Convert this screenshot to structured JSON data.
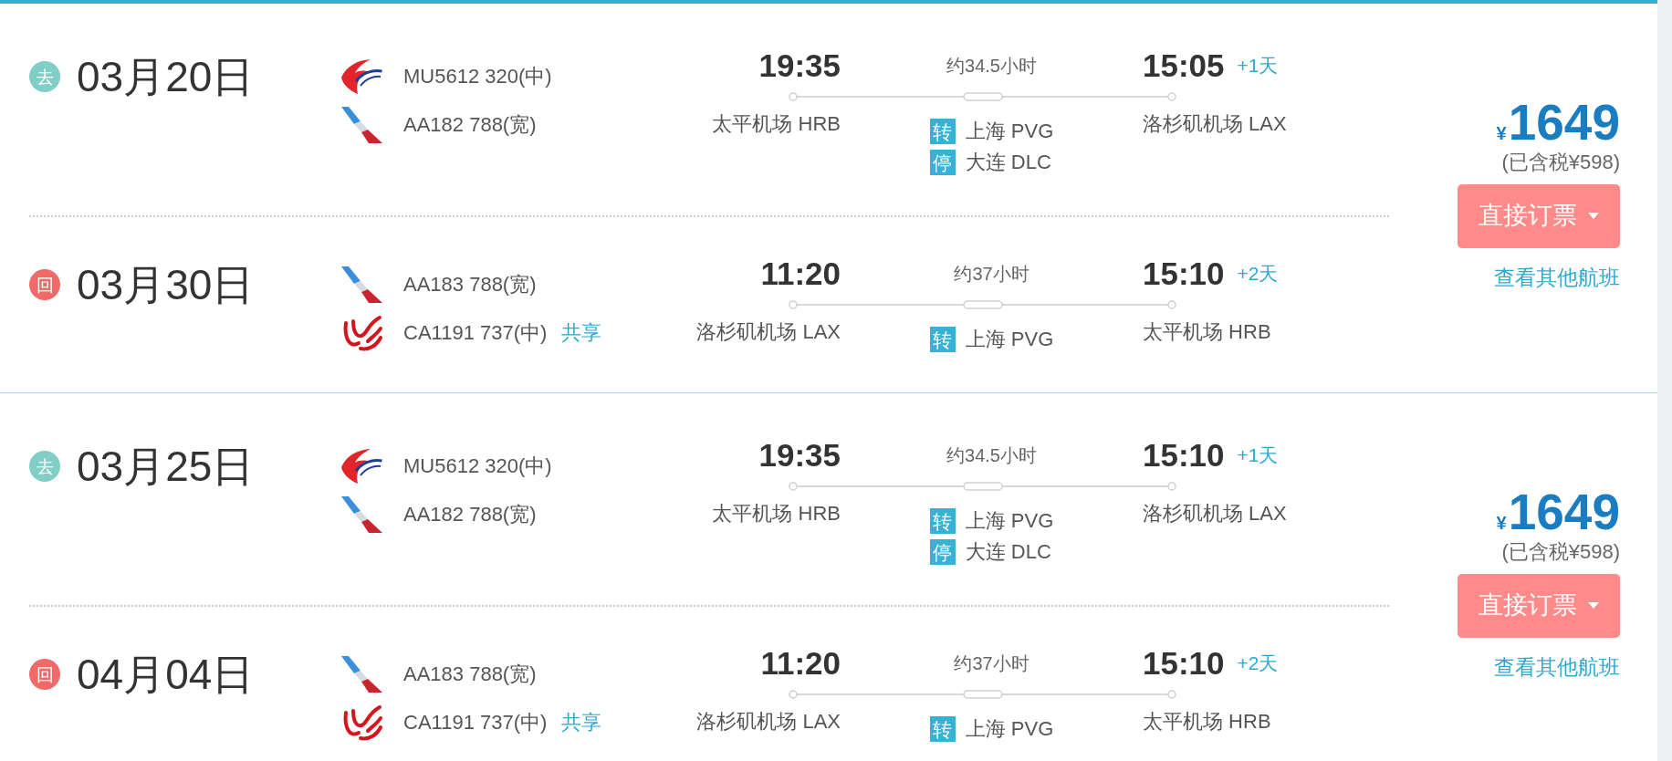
{
  "trips": [
    {
      "segments": [
        {
          "direction": {
            "kind": "outbound",
            "label": "去"
          },
          "date": "03月20日",
          "flights": [
            {
              "kind": "swoosh",
              "number": "MU5612 320(中)"
            },
            {
              "kind": "tailfin",
              "number": "AA182 788(宽)"
            }
          ],
          "departure": {
            "time": "19:35",
            "airport": "太平机场 HRB"
          },
          "duration": "约34.5小时",
          "arrival": {
            "time": "15:05",
            "day_offset": "+1天",
            "airport": "洛杉矶机场 LAX"
          },
          "stops": [
            {
              "label": "转",
              "place": "上海 PVG"
            },
            {
              "label": "停",
              "place": "大连 DLC"
            }
          ]
        },
        {
          "direction": {
            "kind": "return",
            "label": "回"
          },
          "date": "03月30日",
          "flights": [
            {
              "kind": "tailfin",
              "number": "AA183 788(宽)"
            },
            {
              "kind": "ribbon",
              "number": "CA1191 737(中)",
              "codeshare": "共享"
            }
          ],
          "departure": {
            "time": "11:20",
            "airport": "洛杉矶机场 LAX"
          },
          "duration": "约37小时",
          "arrival": {
            "time": "15:10",
            "day_offset": "+2天",
            "airport": "太平机场 HRB"
          },
          "stops": [
            {
              "label": "转",
              "place": "上海 PVG"
            }
          ]
        }
      ],
      "price": {
        "currency": "¥",
        "amount": "1649",
        "tax_note": "(已含税¥598)"
      },
      "book_button": "直接订票",
      "other_flights_link": "查看其他航班"
    },
    {
      "segments": [
        {
          "direction": {
            "kind": "outbound",
            "label": "去"
          },
          "date": "03月25日",
          "flights": [
            {
              "kind": "swoosh",
              "number": "MU5612 320(中)"
            },
            {
              "kind": "tailfin",
              "number": "AA182 788(宽)"
            }
          ],
          "departure": {
            "time": "19:35",
            "airport": "太平机场 HRB"
          },
          "duration": "约34.5小时",
          "arrival": {
            "time": "15:10",
            "day_offset": "+1天",
            "airport": "洛杉矶机场 LAX"
          },
          "stops": [
            {
              "label": "转",
              "place": "上海 PVG"
            },
            {
              "label": "停",
              "place": "大连 DLC"
            }
          ]
        },
        {
          "direction": {
            "kind": "return",
            "label": "回"
          },
          "date": "04月04日",
          "flights": [
            {
              "kind": "tailfin",
              "number": "AA183 788(宽)"
            },
            {
              "kind": "ribbon",
              "number": "CA1191 737(中)",
              "codeshare": "共享"
            }
          ],
          "departure": {
            "time": "11:20",
            "airport": "洛杉矶机场 LAX"
          },
          "duration": "约37小时",
          "arrival": {
            "time": "15:10",
            "day_offset": "+2天",
            "airport": "太平机场 HRB"
          },
          "stops": [
            {
              "label": "转",
              "place": "上海 PVG"
            }
          ]
        }
      ],
      "price": {
        "currency": "¥",
        "amount": "1649",
        "tax_note": "(已含税¥598)"
      },
      "book_button": "直接订票",
      "other_flights_link": "查看其他航班"
    }
  ]
}
